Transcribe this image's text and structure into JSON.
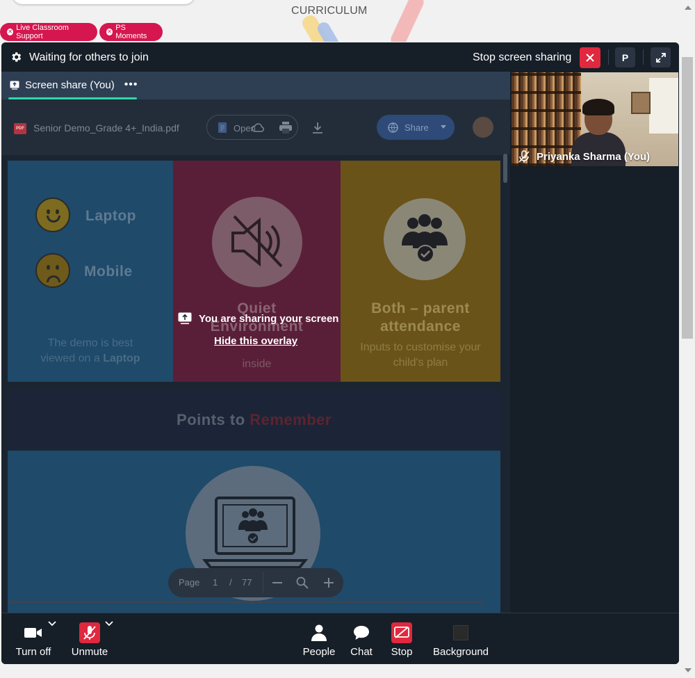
{
  "background_page": {
    "heading": "CURRICULUM",
    "pills": [
      {
        "label": "Live Classroom Support"
      },
      {
        "label": "PS Moments"
      }
    ]
  },
  "meeting": {
    "top_bar": {
      "status": "Waiting for others to join",
      "stop_sharing_label": "Stop screen sharing",
      "participant_initial": "P"
    },
    "tab": {
      "label": "Screen share (You)",
      "more": "•••"
    },
    "shared_screen": {
      "pdf_filename": "Senior Demo_Grade 4+_India.pdf",
      "open_label": "Open",
      "share_label": "Share",
      "pdf_badge": "PDF",
      "slide": {
        "laptop_label": "Laptop",
        "mobile_label": "Mobile",
        "demo_text_1": "The demo is best",
        "demo_text_2": "viewed on a",
        "demo_text_bold": "Laptop",
        "quiet_1": "Quiet",
        "quiet_2": "Environment",
        "quiet_sub": "inside",
        "both_1": "Both – parent",
        "both_2": "attendance",
        "inputs_1": "Inputs to customise your",
        "inputs_2": "child's plan",
        "points_a": "Points to ",
        "points_b": "Remember"
      },
      "page": {
        "label": "Page",
        "current": "1",
        "separator": "/",
        "total": "77"
      },
      "overlay_message": "You are sharing your screen",
      "overlay_hide": "Hide this overlay"
    },
    "self_view": {
      "name": "Priyanka Sharma (You)"
    },
    "controls": [
      {
        "label": "Turn off"
      },
      {
        "label": "Unmute"
      },
      {
        "label": "People"
      },
      {
        "label": "Chat"
      },
      {
        "label": "Stop"
      },
      {
        "label": "Background"
      }
    ],
    "colors": {
      "accent_red": "#e0283e",
      "tab_underline": "#2ed9a4",
      "pill_pink": "#d6164e"
    }
  }
}
